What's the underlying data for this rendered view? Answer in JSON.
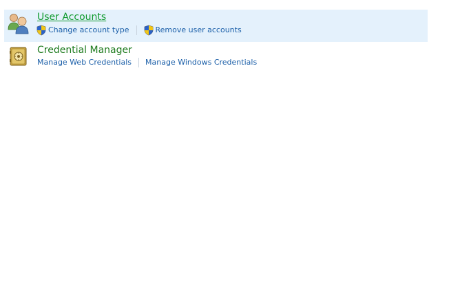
{
  "categories": [
    {
      "title": "User Accounts",
      "icon": "user-accounts-icon",
      "links": [
        {
          "label": "Change account type",
          "icon": "uac-shield-icon"
        },
        {
          "label": "Remove user accounts",
          "icon": "uac-shield-icon"
        }
      ]
    },
    {
      "title": "Credential Manager",
      "icon": "credential-manager-icon",
      "links": [
        {
          "label": "Manage Web Credentials"
        },
        {
          "label": "Manage Windows Credentials"
        }
      ]
    }
  ],
  "colors": {
    "hover_background": "#e4f1fc",
    "title_green": "#1e7b1e",
    "link_blue": "#1a5ea8"
  }
}
